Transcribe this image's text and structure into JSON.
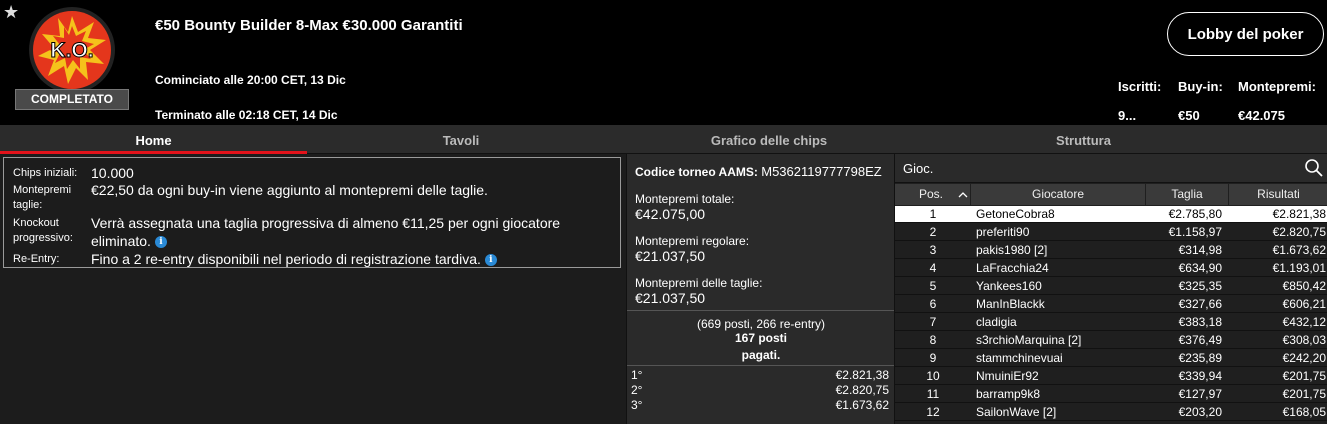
{
  "header": {
    "star": "★",
    "logo_text": "K.O.",
    "status": "COMPLETATO",
    "title": "€50 Bounty Builder 8-Max €30.000 Garantiti",
    "started": "Cominciato alle 20:00 CET, 13 Dic",
    "ended": "Terminato alle 02:18 CET, 14 Dic",
    "lobby_button": "Lobby del poker",
    "stats": [
      {
        "label": "Iscritti:",
        "value": "9..."
      },
      {
        "label": "Buy-in:",
        "value": "€50"
      },
      {
        "label": "Montepremi:",
        "value": "€42.075"
      }
    ],
    "colors": {
      "logo_red": "#e4361c",
      "logo_yellow": "#f5c21b",
      "accent": "#e3131b"
    }
  },
  "tabs": [
    {
      "label": "Home",
      "active": true
    },
    {
      "label": "Tavoli",
      "active": false
    },
    {
      "label": "Grafico delle chips",
      "active": false
    },
    {
      "label": "Struttura",
      "active": false
    }
  ],
  "info": {
    "chips_label": "Chips iniziali:",
    "chips_value": "10.000",
    "bounty_label_1": "Montepremi",
    "bounty_label_2": "taglie:",
    "bounty_value": "€22,50 da ogni buy-in viene aggiunto al montepremi delle taglie.",
    "ko_label_1": "Knockout",
    "ko_label_2": "progressivo:",
    "ko_value_1": "Verrà assegnata una taglia progressiva di almeno €11,25 per ogni giocatore",
    "ko_value_2": "eliminato.",
    "reentry_label": "Re-Entry:",
    "reentry_value": "Fino a 2 re-entry disponibili nel periodo di registrazione tardiva.",
    "info_icon": "i"
  },
  "prizes": {
    "code_label": "Codice torneo AAMS:",
    "code_value": "M5362119777798EZ",
    "total_label": "Montepremi totale:",
    "total_value": "€42.075,00",
    "regular_label": "Montepremi regolare:",
    "regular_value": "€21.037,50",
    "bounty_label": "Montepremi delle taglie:",
    "bounty_value": "€21.037,50",
    "seats_line1": "(669 posti, 266 re-entry)",
    "seats_line2": "167 posti",
    "seats_line3": "pagati.",
    "payouts": [
      {
        "place": "1°",
        "amount": "€2.821,38"
      },
      {
        "place": "2°",
        "amount": "€2.820,75"
      },
      {
        "place": "3°",
        "amount": "€1.673,62"
      }
    ]
  },
  "players": {
    "search_label": "Gioc.",
    "columns": {
      "pos": "Pos.",
      "player": "Giocatore",
      "bounty": "Taglia",
      "result": "Risultati"
    },
    "rows": [
      {
        "pos": "1",
        "name": "GetoneCobra8",
        "bounty": "€2.785,80",
        "result": "€2.821,38"
      },
      {
        "pos": "2",
        "name": "preferiti90",
        "bounty": "€1.158,97",
        "result": "€2.820,75"
      },
      {
        "pos": "3",
        "name": "pakis1980 [2]",
        "bounty": "€314,98",
        "result": "€1.673,62"
      },
      {
        "pos": "4",
        "name": "LaFracchia24",
        "bounty": "€634,90",
        "result": "€1.193,01"
      },
      {
        "pos": "5",
        "name": "Yankees160",
        "bounty": "€325,35",
        "result": "€850,42"
      },
      {
        "pos": "6",
        "name": "ManInBlackk",
        "bounty": "€327,66",
        "result": "€606,21"
      },
      {
        "pos": "7",
        "name": "cladigia",
        "bounty": "€383,18",
        "result": "€432,12"
      },
      {
        "pos": "8",
        "name": "s3rchioMarquina [2]",
        "bounty": "€376,49",
        "result": "€308,03"
      },
      {
        "pos": "9",
        "name": "stammchinevuai",
        "bounty": "€235,89",
        "result": "€242,20"
      },
      {
        "pos": "10",
        "name": "NmuiniEr92",
        "bounty": "€339,94",
        "result": "€201,75"
      },
      {
        "pos": "11",
        "name": "barramp9k8",
        "bounty": "€127,97",
        "result": "€201,75"
      },
      {
        "pos": "12",
        "name": "SailonWave [2]",
        "bounty": "€203,20",
        "result": "€168,05"
      }
    ]
  }
}
